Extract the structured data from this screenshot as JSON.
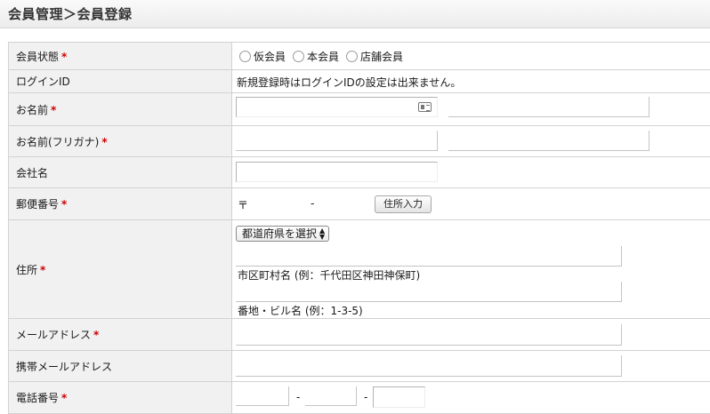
{
  "page": {
    "title": "会員管理＞会員登録"
  },
  "form": {
    "required_mark": "*",
    "rows": {
      "status": {
        "label": "会員状態",
        "options": [
          "仮会員",
          "本会員",
          "店舗会員"
        ]
      },
      "login_id": {
        "label": "ログインID",
        "note": "新規登録時はログインIDの設定は出来ません。"
      },
      "name": {
        "label": "お名前"
      },
      "name_kana": {
        "label": "お名前(フリガナ)"
      },
      "company": {
        "label": "会社名"
      },
      "zip": {
        "label": "郵便番号",
        "symbol": "〒",
        "separator": "-",
        "button": "住所入力"
      },
      "address": {
        "label": "住所",
        "prefecture_select": "都道府県を選択",
        "city_hint": "市区町村名 (例：千代田区神田神保町)",
        "street_hint": "番地・ビル名 (例：1-3-5)"
      },
      "email": {
        "label": "メールアドレス"
      },
      "mobile_email": {
        "label": "携帯メールアドレス"
      },
      "phone": {
        "label": "電話番号",
        "separator": "-"
      }
    }
  },
  "icons": {
    "contact_card": "contact-card-icon",
    "select_arrows": "select-arrows-icon"
  }
}
